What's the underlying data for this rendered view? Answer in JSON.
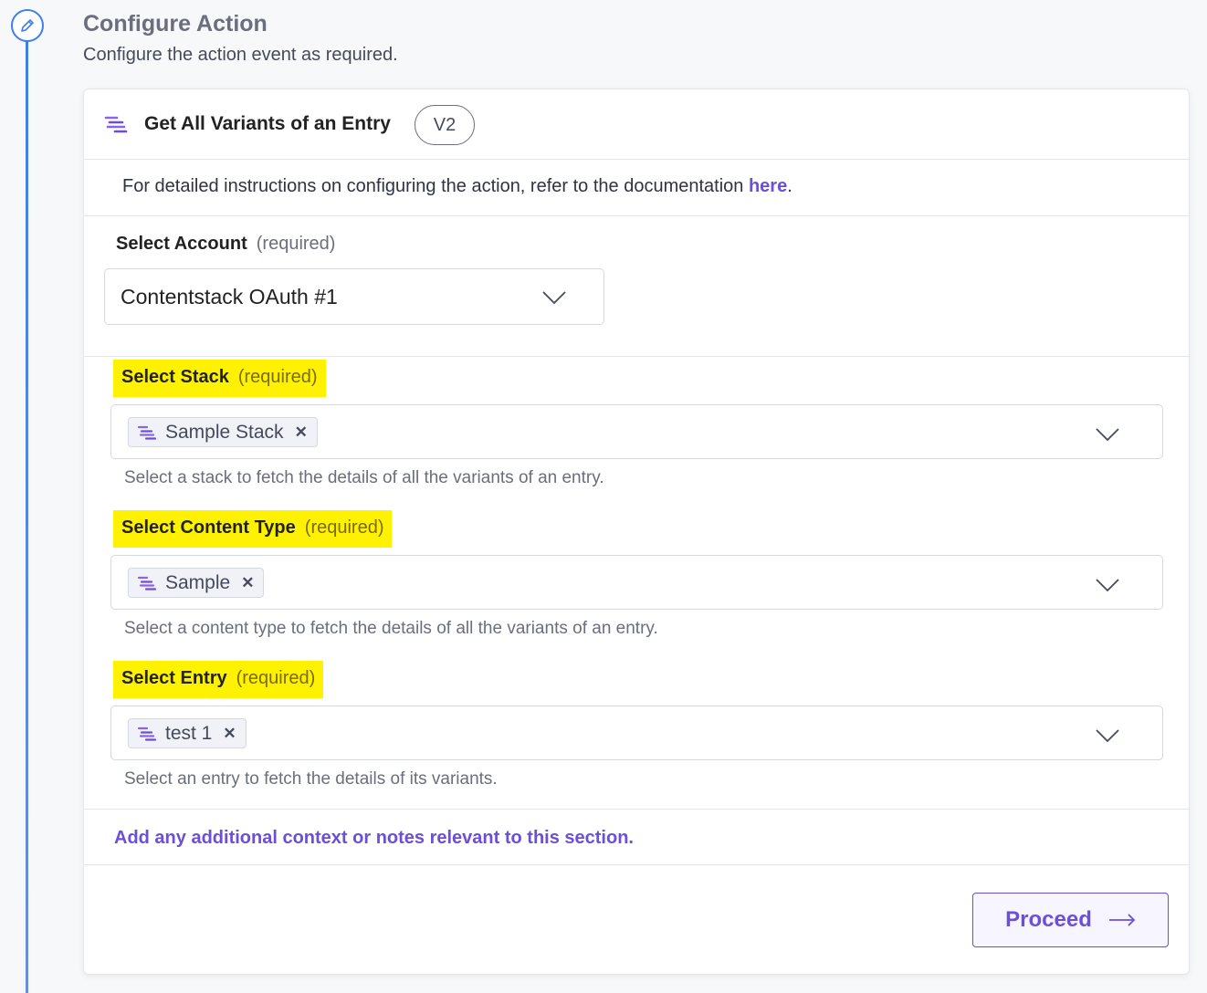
{
  "header": {
    "title": "Configure Action",
    "subtitle": "Configure the action event as required."
  },
  "action": {
    "title": "Get All Variants of an Entry",
    "version": "V2"
  },
  "documentation": {
    "text": "For detailed instructions on configuring the action, refer to the documentation ",
    "link_label": "here",
    "suffix": "."
  },
  "account": {
    "label": "Select Account",
    "required": "(required)",
    "value": "Contentstack OAuth #1"
  },
  "fields": [
    {
      "label": "Select Stack",
      "required": "(required)",
      "chip": "Sample Stack",
      "helper": "Select a stack to fetch the details of all the variants of an entry."
    },
    {
      "label": "Select Content Type",
      "required": "(required)",
      "chip": "Sample",
      "helper": "Select a content type to fetch the details of all the variants of an entry."
    },
    {
      "label": "Select Entry",
      "required": "(required)",
      "chip": "test 1",
      "helper": "Select an entry to fetch the details of its variants."
    }
  ],
  "notes": {
    "link_label": "Add any additional context or notes relevant to this section."
  },
  "footer": {
    "proceed_label": "Proceed"
  },
  "chip_close_glyph": "✕",
  "colors": {
    "accent": "#6c4fd8",
    "highlight": "#fff200",
    "timeline": "#3f7ef0"
  },
  "icons": {
    "step": "pencil-icon",
    "action": "contentstack-logo-icon",
    "dropdown": "chevron-down-icon",
    "chip_remove": "close-icon",
    "proceed": "arrow-right-icon"
  }
}
